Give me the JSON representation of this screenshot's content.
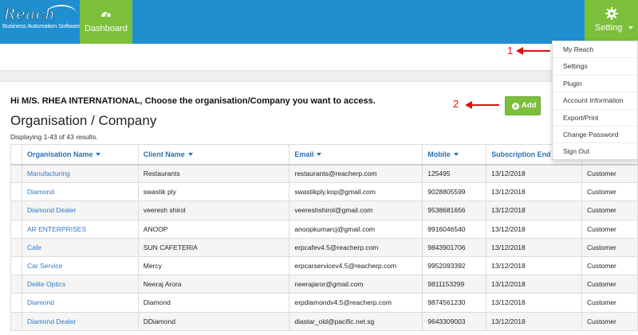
{
  "header": {
    "logo_text": "Reach",
    "logo_tagline": "Business Automation Software",
    "dashboard_label": "Dashboard",
    "setting_label": "Setting"
  },
  "dropdown": {
    "items": [
      {
        "label": "My Reach"
      },
      {
        "label": "Settings"
      },
      {
        "label": "Plugin"
      },
      {
        "label": "Account Information"
      },
      {
        "label": "Export/Print"
      },
      {
        "label": "Change Password"
      },
      {
        "label": "Sign Out"
      }
    ]
  },
  "annotations": {
    "one": "1",
    "two": "2"
  },
  "main": {
    "greeting": "Hi M/S. RHEA INTERNATIONAL, Choose the organisation/Company you want to access.",
    "title": "Organisation / Company",
    "results": "Displaying 1-43 of 43 results.",
    "add_label": "Add"
  },
  "table": {
    "columns": [
      "Organisation Name",
      "Client Name",
      "Email",
      "Mobile",
      "Subscription End D",
      ""
    ],
    "rows": [
      {
        "org": "Manufacturing",
        "client": "Restaurants",
        "email": "restaurants@reacherp.com",
        "mobile": "125495",
        "end": "13/12/2018",
        "type": "Customer"
      },
      {
        "org": "Diamond",
        "client": "swastik ply",
        "email": "swastikply.kop@gmail.com",
        "mobile": "9028805599",
        "end": "13/12/2018",
        "type": "Customer"
      },
      {
        "org": "Diamond Dealer",
        "client": "veeresh shirol",
        "email": "veereshshirol@gmail.com",
        "mobile": "9538681656",
        "end": "13/12/2018",
        "type": "Customer"
      },
      {
        "org": "AR ENTERPRISES",
        "client": "ANOOP",
        "email": "anoopkumarcj@gmail.com",
        "mobile": "9916046540",
        "end": "13/12/2018",
        "type": "Customer"
      },
      {
        "org": "Cafe",
        "client": "SUN CAFETERIA",
        "email": "erpcafev4.5@reacherp.com",
        "mobile": "9843901706",
        "end": "13/12/2018",
        "type": "Customer"
      },
      {
        "org": "Car Service",
        "client": "Mercy",
        "email": "erpcarservicev4.5@reacherp.com",
        "mobile": "9952093392",
        "end": "13/12/2018",
        "type": "Customer"
      },
      {
        "org": "Delite Optics",
        "client": "Neeraj Arora",
        "email": "neerajaror@gmail.com",
        "mobile": "9811153299",
        "end": "13/12/2018",
        "type": "Customer"
      },
      {
        "org": "Diamond",
        "client": "Diamond",
        "email": "erpdiamondv4.5@reacherp.com",
        "mobile": "9874561230",
        "end": "13/12/2018",
        "type": "Customer"
      },
      {
        "org": "Diamond Dealer",
        "client": "DDiamond",
        "email": "diastar_old@pacific.net.sg",
        "mobile": "9643309003",
        "end": "13/12/2018",
        "type": "Customer"
      }
    ]
  },
  "colors": {
    "header_blue": "#1f8fcf",
    "accent_green": "#7bbf3a",
    "link_blue": "#2f78c4",
    "annotation_red": "#e01010"
  }
}
